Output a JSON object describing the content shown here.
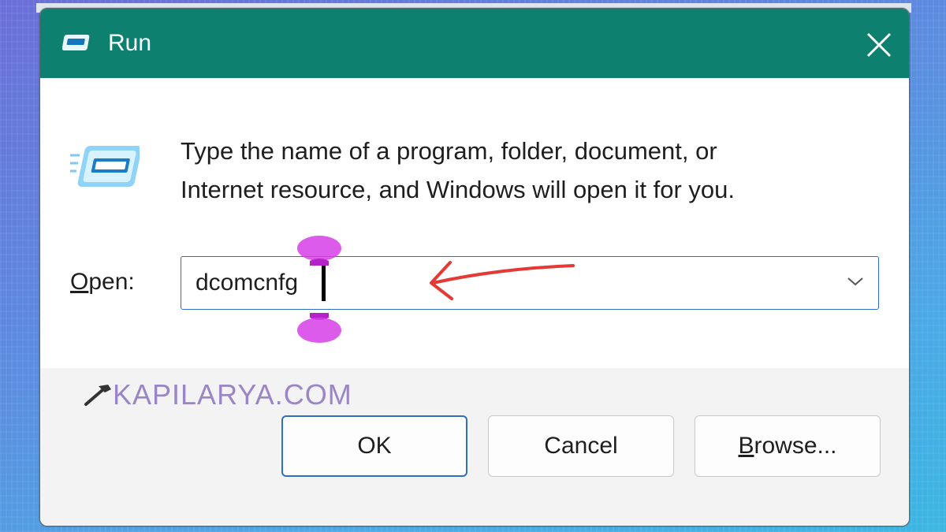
{
  "window": {
    "title": "Run",
    "close_icon": "close-icon",
    "app_icon": "run-icon"
  },
  "description": {
    "line1": "Type the name of a program, folder, document, or",
    "line2": "Internet resource, and Windows will open it for you."
  },
  "open": {
    "label_accesskey": "O",
    "label_rest": "pen:",
    "value": "dcomcnfg"
  },
  "buttons": {
    "ok": "OK",
    "cancel": "Cancel",
    "browse_accesskey": "B",
    "browse_rest": "rowse..."
  },
  "watermark": "KAPILARYA.COM",
  "colors": {
    "titlebar": "#0d8070",
    "accent": "#2e6fbf",
    "annotation_arrow": "#e53935",
    "selection_handles": "#d63ee6"
  }
}
